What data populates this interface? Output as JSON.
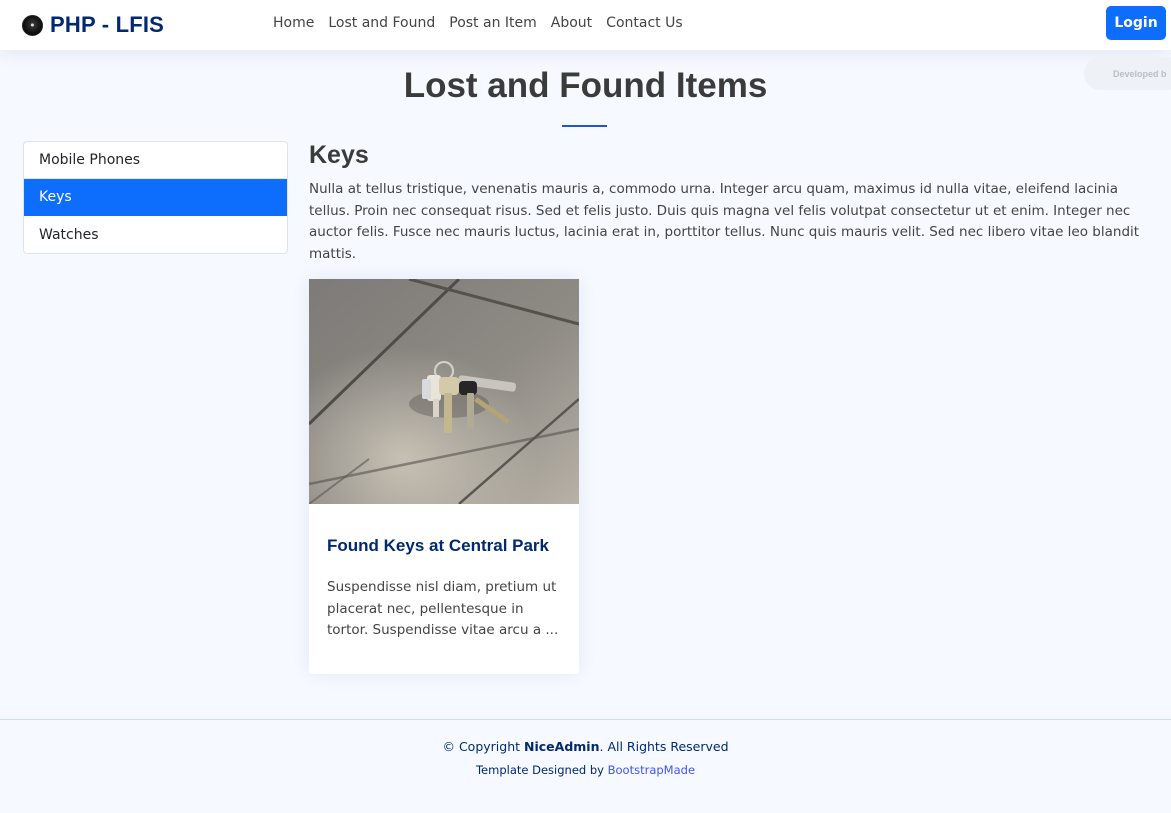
{
  "header": {
    "brand_title": "PHP - LFIS",
    "nav": [
      "Home",
      "Lost and Found",
      "Post an Item",
      "About",
      "Contact Us"
    ],
    "login_label": "Login",
    "dev_badge": "Developed b"
  },
  "page": {
    "title": "Lost and Found Items"
  },
  "sidebar": {
    "categories": [
      "Mobile Phones",
      "Keys",
      "Watches"
    ],
    "active": "Keys"
  },
  "main": {
    "category_title": "Keys",
    "category_description": "Nulla at tellus tristique, venenatis mauris a, commodo urna. Integer arcu quam, maximus id nulla vitae, eleifend lacinia tellus. Proin nec consequat risus. Sed et felis justo. Duis quis magna vel felis volutpat consectetur ut et enim. Integer nec auctor felis. Fusce nec mauris luctus, lacinia erat in, porttitor tellus. Nunc quis mauris velit. Sed nec libero vitae leo blandit mattis.",
    "items": [
      {
        "title": "Found Keys at Central Park",
        "excerpt": "Suspendisse nisl diam, pretium ut placerat nec, pellentesque in tortor. Suspendisse vitae arcu a ..."
      }
    ]
  },
  "footer": {
    "copyright_prefix": "© Copyright",
    "copyright_brand": "NiceAdmin",
    "copyright_suffix": ". All Rights Reserved",
    "credits_prefix": "Template Designed by",
    "credits_link": "BootstrapMade"
  },
  "colors": {
    "accent": "#0d6efd",
    "brand_navy": "#012970",
    "page_bg": "#f6f9ff"
  }
}
